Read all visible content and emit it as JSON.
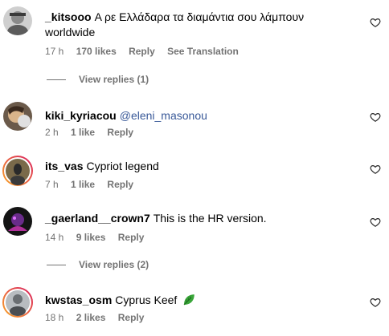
{
  "comments": [
    {
      "username": "_kitsooo",
      "text_line1": "Α ρε Ελλάδαρα τα διαμάντια σου λάμπουν",
      "text_line2": "worldwide",
      "time": "17 h",
      "likes": "170 likes",
      "reply": "Reply",
      "translate": "See Translation",
      "view_replies": "View replies (1)"
    },
    {
      "username": "kiki_kyriacou",
      "mention": "@eleni_masonou",
      "time": "2 h",
      "likes": "1 like",
      "reply": "Reply"
    },
    {
      "username": "its_vas",
      "text": "Cypriot legend",
      "time": "7 h",
      "likes": "1 like",
      "reply": "Reply"
    },
    {
      "username": "_gaerland__crown7",
      "text": "This is the HR version.",
      "time": "14 h",
      "likes": "9 likes",
      "reply": "Reply",
      "view_replies": "View replies (2)"
    },
    {
      "username": "kwstas_osm",
      "text": "Cyprus Keef",
      "emoji": "leafy-green-emoji",
      "time": "18 h",
      "likes": "2 likes",
      "reply": "Reply"
    }
  ],
  "icons": {
    "like": "heart-outline-icon"
  },
  "colors": {
    "mention": "#385898",
    "meta": "#737373",
    "story_ring_start": "#f9a825",
    "story_ring_end": "#d81b60"
  }
}
